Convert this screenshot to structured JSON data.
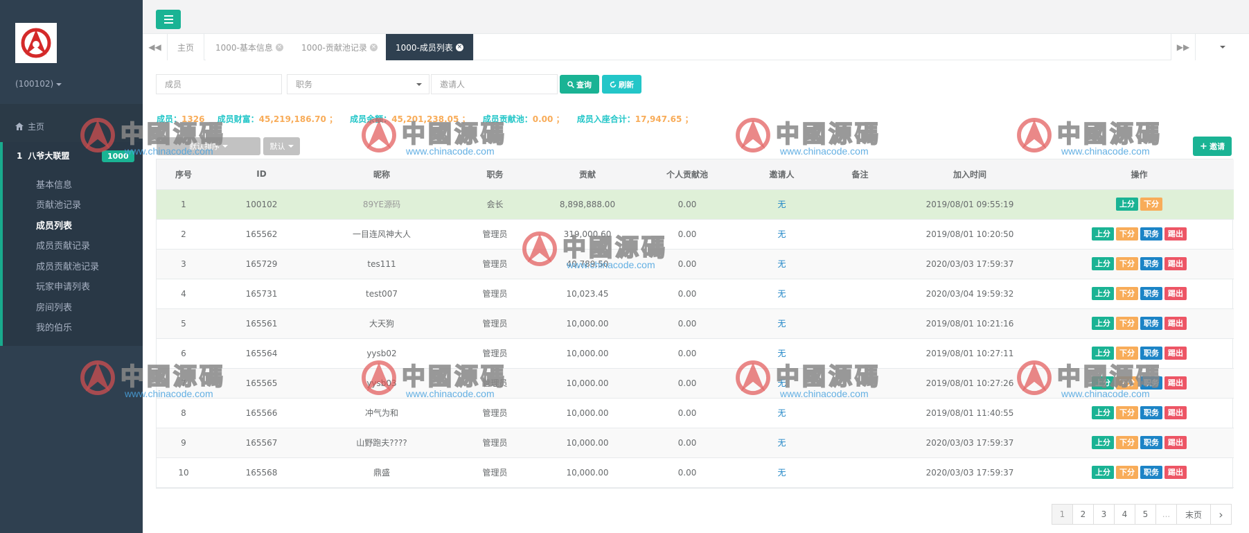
{
  "sidebar": {
    "user_id": "(100102)",
    "home_label": "主页",
    "group": {
      "index": "1",
      "label": "八爷大联盟",
      "badge": "1000"
    },
    "items": [
      {
        "label": "基本信息",
        "active": false
      },
      {
        "label": "贡献池记录",
        "active": false
      },
      {
        "label": "成员列表",
        "active": true
      },
      {
        "label": "成员贡献记录",
        "active": false
      },
      {
        "label": "成员贡献池记录",
        "active": false
      },
      {
        "label": "玩家申请列表",
        "active": false
      },
      {
        "label": "房间列表",
        "active": false
      },
      {
        "label": "我的伯乐",
        "active": false
      }
    ]
  },
  "tabs": [
    {
      "label": "主页"
    },
    {
      "label": "1000-基本信息"
    },
    {
      "label": "1000-贡献池记录"
    },
    {
      "label": "1000-成员列表"
    }
  ],
  "filters": {
    "member_placeholder": "成员",
    "role_placeholder": "职务",
    "inviter_placeholder": "邀请人",
    "query_label": "查询",
    "refresh_label": "刷新"
  },
  "summary": {
    "members_label": "成员：",
    "members_value": "1326",
    "wealth_label": "成员财富：",
    "wealth_value": "45,219,186.70 ；",
    "balance_label": "成员余额：",
    "balance_value": "45,201,238.05 ；",
    "pool_label": "成员贡献池：",
    "pool_value": "0.00 ；",
    "seat_label": "成员入座合计：",
    "seat_value": "17,947.65 ；"
  },
  "toolbar": {
    "sort_label": "默认排序",
    "default_label": "默认",
    "invite_label": "邀请"
  },
  "table": {
    "headers": [
      "序号",
      "ID",
      "昵称",
      "职务",
      "贡献",
      "个人贡献池",
      "邀请人",
      "备注",
      "加入时间",
      "操作"
    ],
    "rows": [
      {
        "no": "1",
        "id": "100102",
        "nick": "89YE源码",
        "role": "会长",
        "contrib": "8,898,888.00",
        "pool": "0.00",
        "inviter": "无",
        "note": "",
        "joined": "2019/08/01 09:55:19"
      },
      {
        "no": "2",
        "id": "165562",
        "nick": "一目连风神大人",
        "role": "管理员",
        "contrib": "319,000.60",
        "pool": "0.00",
        "inviter": "无",
        "note": "",
        "joined": "2019/08/01 10:20:50"
      },
      {
        "no": "3",
        "id": "165729",
        "nick": "tes111",
        "role": "管理员",
        "contrib": "40,789.50",
        "pool": "0.00",
        "inviter": "无",
        "note": "",
        "joined": "2020/03/03 17:59:37"
      },
      {
        "no": "4",
        "id": "165731",
        "nick": "test007",
        "role": "管理员",
        "contrib": "10,023.45",
        "pool": "0.00",
        "inviter": "无",
        "note": "",
        "joined": "2020/03/04 19:59:32"
      },
      {
        "no": "5",
        "id": "165561",
        "nick": "大天狗",
        "role": "管理员",
        "contrib": "10,000.00",
        "pool": "0.00",
        "inviter": "无",
        "note": "",
        "joined": "2019/08/01 10:21:16"
      },
      {
        "no": "6",
        "id": "165564",
        "nick": "yysb02",
        "role": "管理员",
        "contrib": "10,000.00",
        "pool": "0.00",
        "inviter": "无",
        "note": "",
        "joined": "2019/08/01 10:27:11"
      },
      {
        "no": "7",
        "id": "165565",
        "nick": "yysb03",
        "role": "管理员",
        "contrib": "10,000.00",
        "pool": "0.00",
        "inviter": "无",
        "note": "",
        "joined": "2019/08/01 10:27:26"
      },
      {
        "no": "8",
        "id": "165566",
        "nick": "冲气为和",
        "role": "管理员",
        "contrib": "10,000.00",
        "pool": "0.00",
        "inviter": "无",
        "note": "",
        "joined": "2019/08/01 11:40:55"
      },
      {
        "no": "9",
        "id": "165567",
        "nick": "山野跑夫????",
        "role": "管理员",
        "contrib": "10,000.00",
        "pool": "0.00",
        "inviter": "无",
        "note": "",
        "joined": "2020/03/03 17:59:37"
      },
      {
        "no": "10",
        "id": "165568",
        "nick": "鼎盛",
        "role": "管理员",
        "contrib": "10,000.00",
        "pool": "0.00",
        "inviter": "无",
        "note": "",
        "joined": "2020/03/03 17:59:37"
      }
    ],
    "ops": {
      "up": "上分",
      "down": "下分",
      "job": "职务",
      "kick": "踢出"
    }
  },
  "pagination": {
    "pages": [
      "1",
      "2",
      "3",
      "4",
      "5"
    ],
    "ellipsis": "...",
    "last": "末页",
    "next": "›"
  },
  "watermark": {
    "title": "中國源碼",
    "url": "www.chinacode.com"
  },
  "colors": {
    "sidebar": "#2f4050",
    "primary": "#1ab394",
    "info": "#23c6c8",
    "warning": "#f8ac59",
    "danger": "#ed5565",
    "blue": "#1c84c6"
  }
}
